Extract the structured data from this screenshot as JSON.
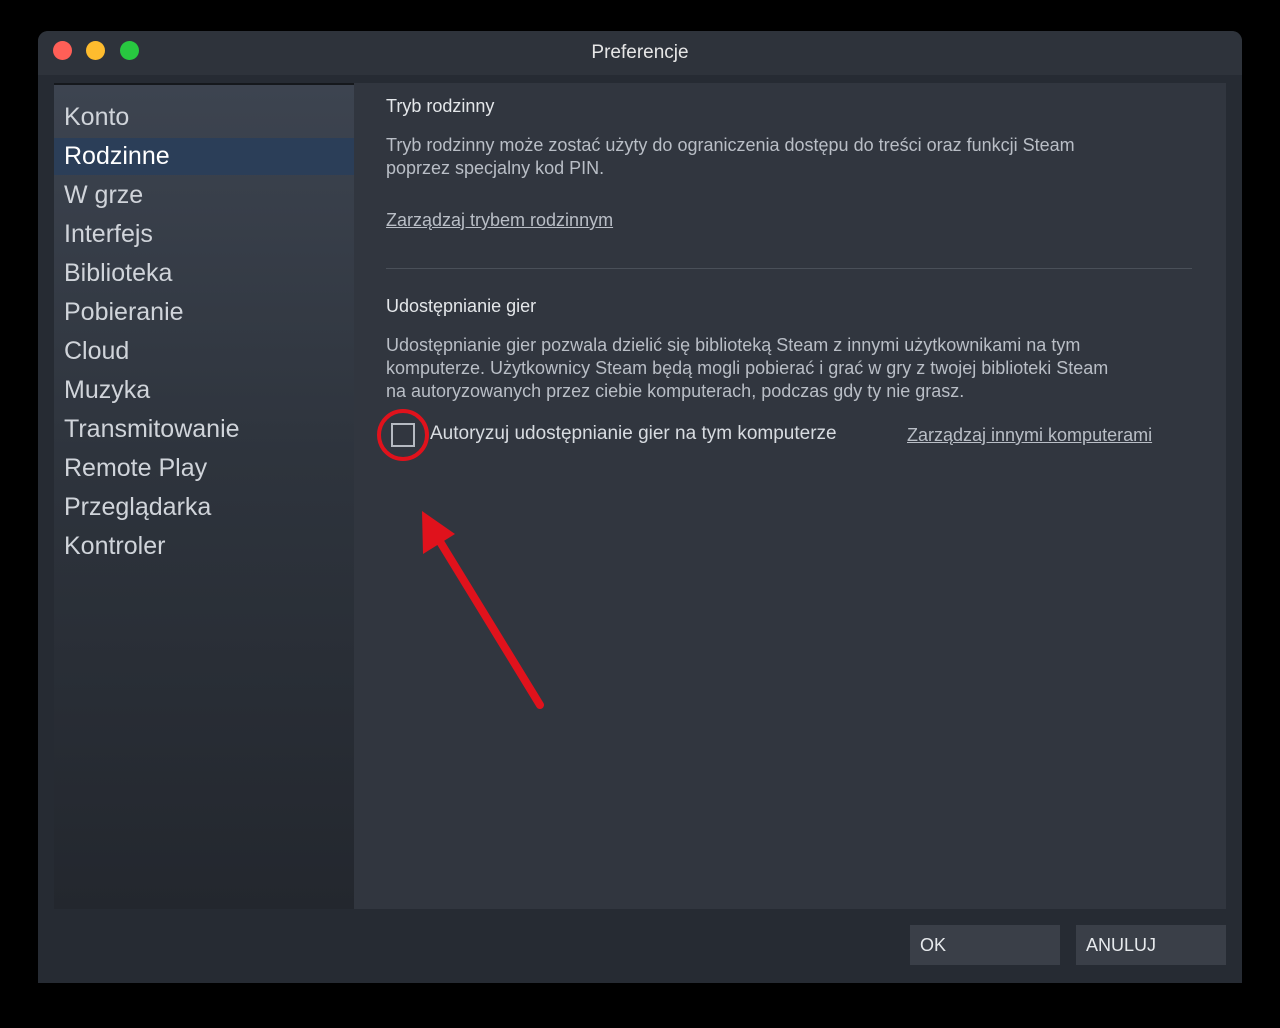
{
  "window": {
    "title": "Preferencje"
  },
  "sidebar": {
    "items": [
      {
        "label": "Konto"
      },
      {
        "label": "Rodzinne"
      },
      {
        "label": "W grze"
      },
      {
        "label": "Interfejs"
      },
      {
        "label": "Biblioteka"
      },
      {
        "label": "Pobieranie"
      },
      {
        "label": "Cloud"
      },
      {
        "label": "Muzyka"
      },
      {
        "label": "Transmitowanie"
      },
      {
        "label": "Remote Play"
      },
      {
        "label": "Przeglądarka"
      },
      {
        "label": "Kontroler"
      }
    ],
    "active": "Rodzinne"
  },
  "family": {
    "title": "Tryb rodzinny",
    "desc_line1": "Tryb rodzinny może zostać użyty do ograniczenia dostępu do treści oraz funkcji Steam",
    "desc_line2": "poprzez specjalny kod PIN.",
    "manage_link": "Zarządzaj trybem rodzinnym"
  },
  "sharing": {
    "title": "Udostępnianie gier",
    "desc_line1": "Udostępnianie gier pozwala dzielić się biblioteką Steam z innymi użytkownikami na tym",
    "desc_line2": "komputerze. Użytkownicy Steam będą mogli pobierać i grać w gry z twojej biblioteki Steam",
    "desc_line3": "na autoryzowanych przez ciebie komputerach, podczas gdy ty nie grasz.",
    "authorize_label": "Autoryzuj udostępnianie gier na tym komputerze",
    "authorize_checked": false,
    "manage_link": "Zarządzaj innymi komputerami"
  },
  "footer": {
    "ok_label": "OK",
    "cancel_label": "ANULUJ"
  },
  "colors": {
    "annotation": "#e0121c",
    "active_nav": "#2b3e58"
  }
}
